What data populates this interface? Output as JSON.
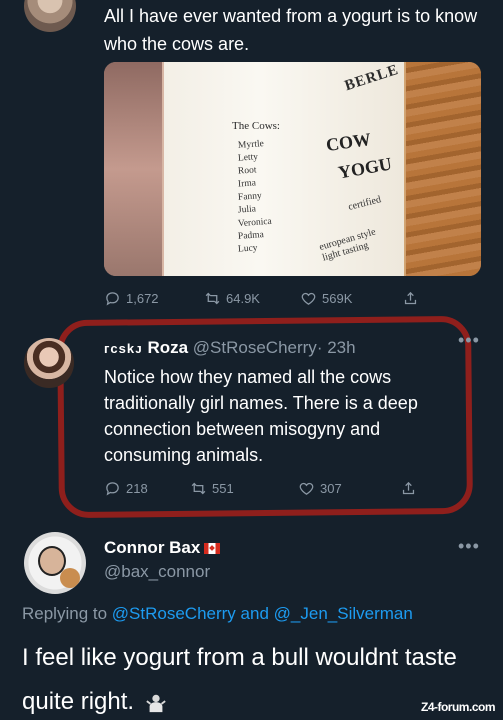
{
  "tweet1": {
    "text": "All I have ever wanted from a yogurt is to know who the cows are.",
    "photo": {
      "cows_title": "The Cows:",
      "cow_names": [
        "Myrtle",
        "Letty",
        "Root",
        "Irma",
        "Fanny",
        "Julia",
        "Veronica",
        "Padma",
        "Lucy"
      ],
      "brand_top": "BERLE",
      "brand_mid": "COW",
      "brand_low": "YOGU",
      "certified": "certified",
      "style": "european style",
      "light": "light tasting"
    },
    "replies": "1,672",
    "retweets": "64.9K",
    "likes": "569K"
  },
  "tweet2": {
    "tag": "ᴦcskᴊ",
    "name": "Roza",
    "handle": "@StRoseCherry",
    "time": "· 23h",
    "more": "•••",
    "text": "Notice how they named all the cows traditionally girl names. There is a deep connection between misogyny and consuming animals.",
    "replies": "218",
    "retweets": "551",
    "likes": "307"
  },
  "tweet3": {
    "name": "Connor Bax",
    "handle": "@bax_connor",
    "more": "•••",
    "replying_prefix": "Replying to",
    "replying_user1": "@StRoseCherry",
    "replying_and": "and",
    "replying_user2": "@_Jen_Silverman",
    "text": "I feel like yogurt from a bull wouldnt taste quite right."
  },
  "watermark": "Z4-forum.com",
  "colors": {
    "background": "#15202b",
    "muted": "#8b98a5",
    "link": "#1d9bf0",
    "circle": "#8f1f1c"
  }
}
